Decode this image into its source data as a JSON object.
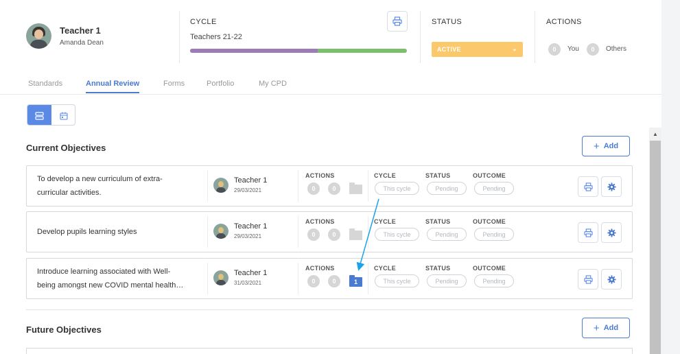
{
  "profile": {
    "name": "Teacher 1",
    "subname": "Amanda Dean"
  },
  "cycle": {
    "label": "CYCLE",
    "value": "Teachers 21-22",
    "progress_purple": 0.59,
    "purple": "#9c7bb6",
    "green": "#7bbf6a",
    "print_icon": "printer-icon"
  },
  "status": {
    "label": "STATUS",
    "value": "ACTIVE",
    "color": "#fbc96b",
    "chevron": "⌄"
  },
  "actions": {
    "label": "ACTIONS",
    "you_count": "0",
    "you_label": "You",
    "others_count": "0",
    "others_label": "Others"
  },
  "tabs": [
    {
      "label": "Standards",
      "active": false
    },
    {
      "label": "Annual Review",
      "active": true
    },
    {
      "label": "Forms",
      "active": false
    },
    {
      "label": "Portfolio",
      "active": false
    },
    {
      "label": "My CPD",
      "active": false
    }
  ],
  "view_toggle": {
    "list_icon": "list-view-icon",
    "calendar_icon": "calendar-icon"
  },
  "current": {
    "title": "Current Objectives",
    "add_label": "Add",
    "columns": {
      "actions": "ACTIONS",
      "cycle": "CYCLE",
      "status": "STATUS",
      "outcome": "OUTCOME"
    },
    "objectives": [
      {
        "text_line1": "To develop a new curriculum of extra-",
        "text_line2": "curricular activities.",
        "owner": "Teacher 1",
        "date": "29/03/2021",
        "count_a": "0",
        "count_b": "0",
        "folder_count": "",
        "cycle": "This cycle",
        "status": "Pending",
        "outcome": "Pending"
      },
      {
        "text_line1": "Develop pupils learning styles",
        "text_line2": "",
        "owner": "Teacher 1",
        "date": "29/03/2021",
        "count_a": "0",
        "count_b": "0",
        "folder_count": "",
        "cycle": "This cycle",
        "status": "Pending",
        "outcome": "Pending"
      },
      {
        "text_line1": "Introduce learning associated with Well-",
        "text_line2": "being amongst new COVID mental health…",
        "owner": "Teacher 1",
        "date": "31/03/2021",
        "count_a": "0",
        "count_b": "0",
        "folder_count": "1",
        "cycle": "This cycle",
        "status": "Pending",
        "outcome": "Pending"
      }
    ]
  },
  "future": {
    "title": "Future Objectives",
    "add_label": "Add"
  },
  "colors": {
    "accent": "#4a7bd0",
    "folder_active": "#4a7bd0",
    "folder_inactive": "#d6d6d6",
    "annotation_arrow": "#1aa3e8"
  }
}
